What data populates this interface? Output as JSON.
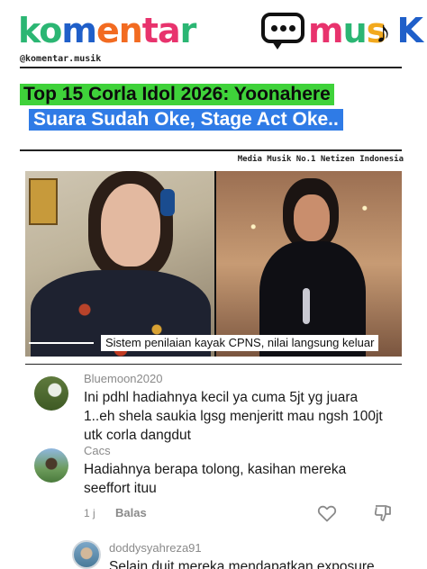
{
  "header": {
    "logo_part1": "komentar",
    "logo_part2": "musik",
    "handle": "@komentar.musik",
    "tagline": "Media Musik No.1 Netizen Indonesia"
  },
  "headline": {
    "line1": "Top 15 Corla Idol 2026: Yoonahere",
    "line2": "Suara Sudah Oke, Stage Act Oke.."
  },
  "image": {
    "caption": "Sistem penilaian kayak CPNS, nilai langsung keluar"
  },
  "comments": [
    {
      "username": "Bluemoon2020",
      "text": "Ini pdhl hadiahnya kecil ya cuma 5jt yg juara 1..eh shela saukia lgsg menjeritt mau ngsh 100jt utk corla dangdut"
    },
    {
      "username": "Cacs",
      "text": "Hadiahnya berapa tolong, kasihan mereka seeffort ituu",
      "time": "1 j",
      "reply_label": "Balas"
    },
    {
      "username": "doddysyahreza91",
      "text": "Selain duit mereka mendapatkan exposure"
    }
  ],
  "colors": {
    "headline1_bg": "#3fd23a",
    "headline2_bg": "#2f7be6",
    "muted_text": "#8a8a8a"
  },
  "icons": {
    "like": "heart-icon",
    "dislike": "thumbs-down-icon"
  }
}
